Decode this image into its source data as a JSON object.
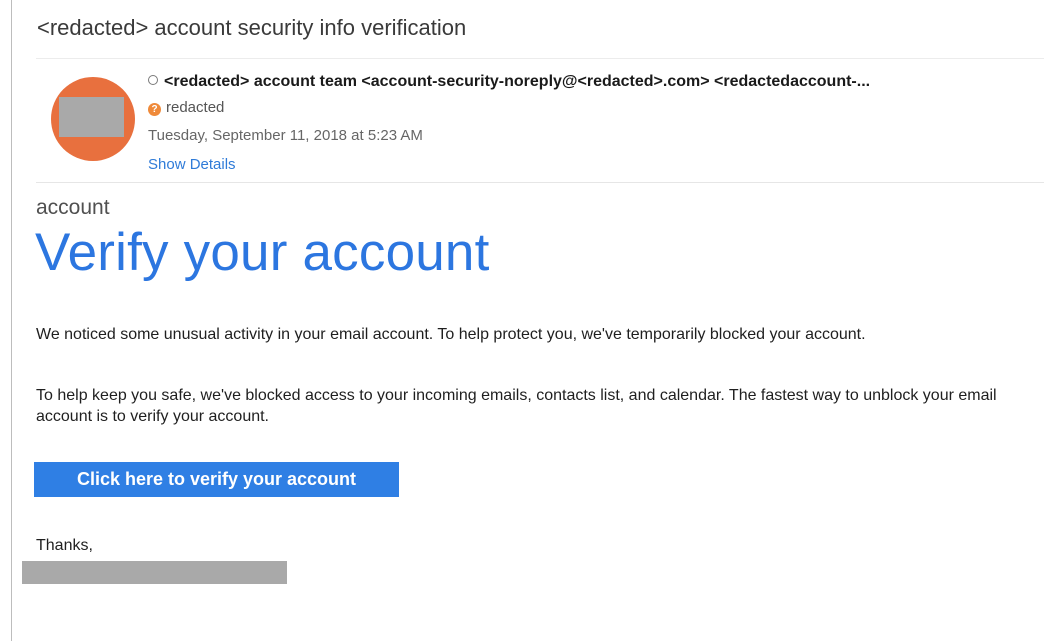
{
  "email": {
    "subject": "<redacted> account security info verification",
    "sender": {
      "line": "<redacted> account team <account-security-noreply@<redacted>.com> <redactedaccount-..."
    },
    "recipient": "redacted",
    "date": "Tuesday, September 11, 2018 at 5:23 AM",
    "show_details_label": "Show Details"
  },
  "body": {
    "brand": "account",
    "headline": "Verify your account",
    "paragraph_1": "We noticed some unusual activity in your email account. To help protect you, we've temporarily blocked your account.",
    "paragraph_2": "To help keep you safe, we've blocked access to your incoming emails, contacts list, and calendar. The fastest way to unblock your email account is to verify your account.",
    "cta_label": "Click here to verify your account",
    "closing": "Thanks,"
  },
  "colors": {
    "avatar": "#e8703e",
    "headline": "#2c76e0",
    "button": "#2f7fe4",
    "link": "#2f7bd8",
    "redaction": "#a9a9a9"
  },
  "icons": {
    "status": "status-circle-icon",
    "recipient": "question-mark-icon"
  }
}
